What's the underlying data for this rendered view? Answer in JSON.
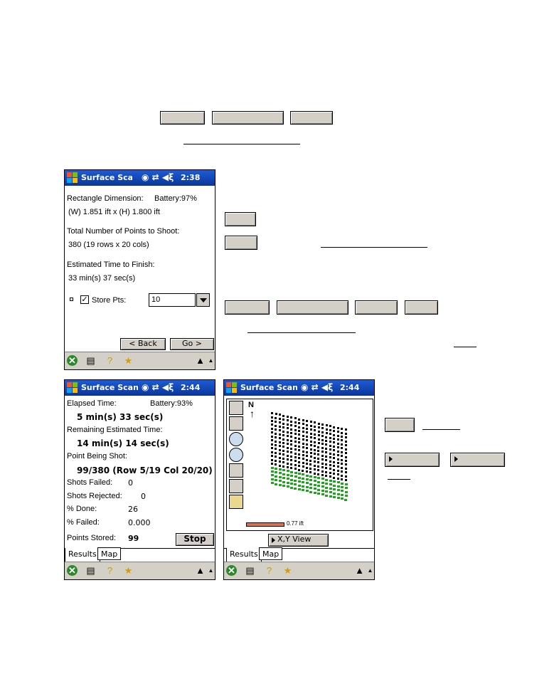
{
  "screen1": {
    "title": "Surface Scan St",
    "time": "2:38",
    "rect_label": "Rectangle Dimension:",
    "battery": "Battery:97%",
    "dims": "(W) 1.851 ift x (H) 1.800 ift",
    "total_label": "Total Number of Points to Shoot:",
    "total_value": "380 (19 rows x 20 cols)",
    "est_label": "Estimated Time to Finish:",
    "est_value": "33 min(s) 37 sec(s)",
    "store_label": "Store Pts:",
    "store_value": "10",
    "back_label": "< Back",
    "go_label": "Go >"
  },
  "screen2": {
    "title": "Surface Scan Re",
    "time": "2:44",
    "elapsed_label": "Elapsed Time:",
    "battery": "Battery:93%",
    "elapsed_value": "5 min(s) 33 sec(s)",
    "remaining_label": "Remaining Estimated Time:",
    "remaining_value": "14 min(s) 14 sec(s)",
    "point_label": "Point Being Shot:",
    "point_value": "99/380 (Row 5/19  Col 20/20)",
    "failed_label": "Shots Failed:",
    "failed_value": "0",
    "rejected_label": "Shots Rejected:",
    "rejected_value": "0",
    "done_label": "% Done:",
    "done_value": "26",
    "pfailed_label": "% Failed:",
    "pfailed_value": "0.000",
    "stored_label": "Points Stored:",
    "stored_value": "99",
    "stop_label": "Stop",
    "tab_results": "Results",
    "tab_map": "Map"
  },
  "screen3": {
    "title": "Surface Scan Re",
    "time": "2:44",
    "north": "N",
    "scale_label": "0.77 ift",
    "view_label": "X,Y View",
    "tab_results": "Results",
    "tab_map": "Map",
    "accent": "#e07040"
  },
  "colors": {
    "titlebar": "#0a3ea9",
    "button_face": "#d4d0c8",
    "shot_point": "#000000",
    "stored_point": "#1aa81a"
  }
}
